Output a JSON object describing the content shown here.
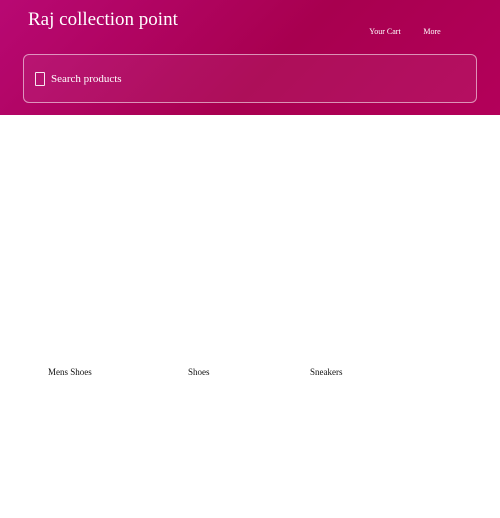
{
  "header": {
    "store_name": "Raj collection point",
    "cart_label": "Your Cart",
    "more_label": "More",
    "background_color": "#a8004f"
  },
  "search": {
    "placeholder": "Search products",
    "value": "",
    "icon": "search-icon"
  },
  "categories": [
    {
      "label": "Mens Shoes"
    },
    {
      "label": "Shoes"
    },
    {
      "label": "Sneakers"
    }
  ]
}
